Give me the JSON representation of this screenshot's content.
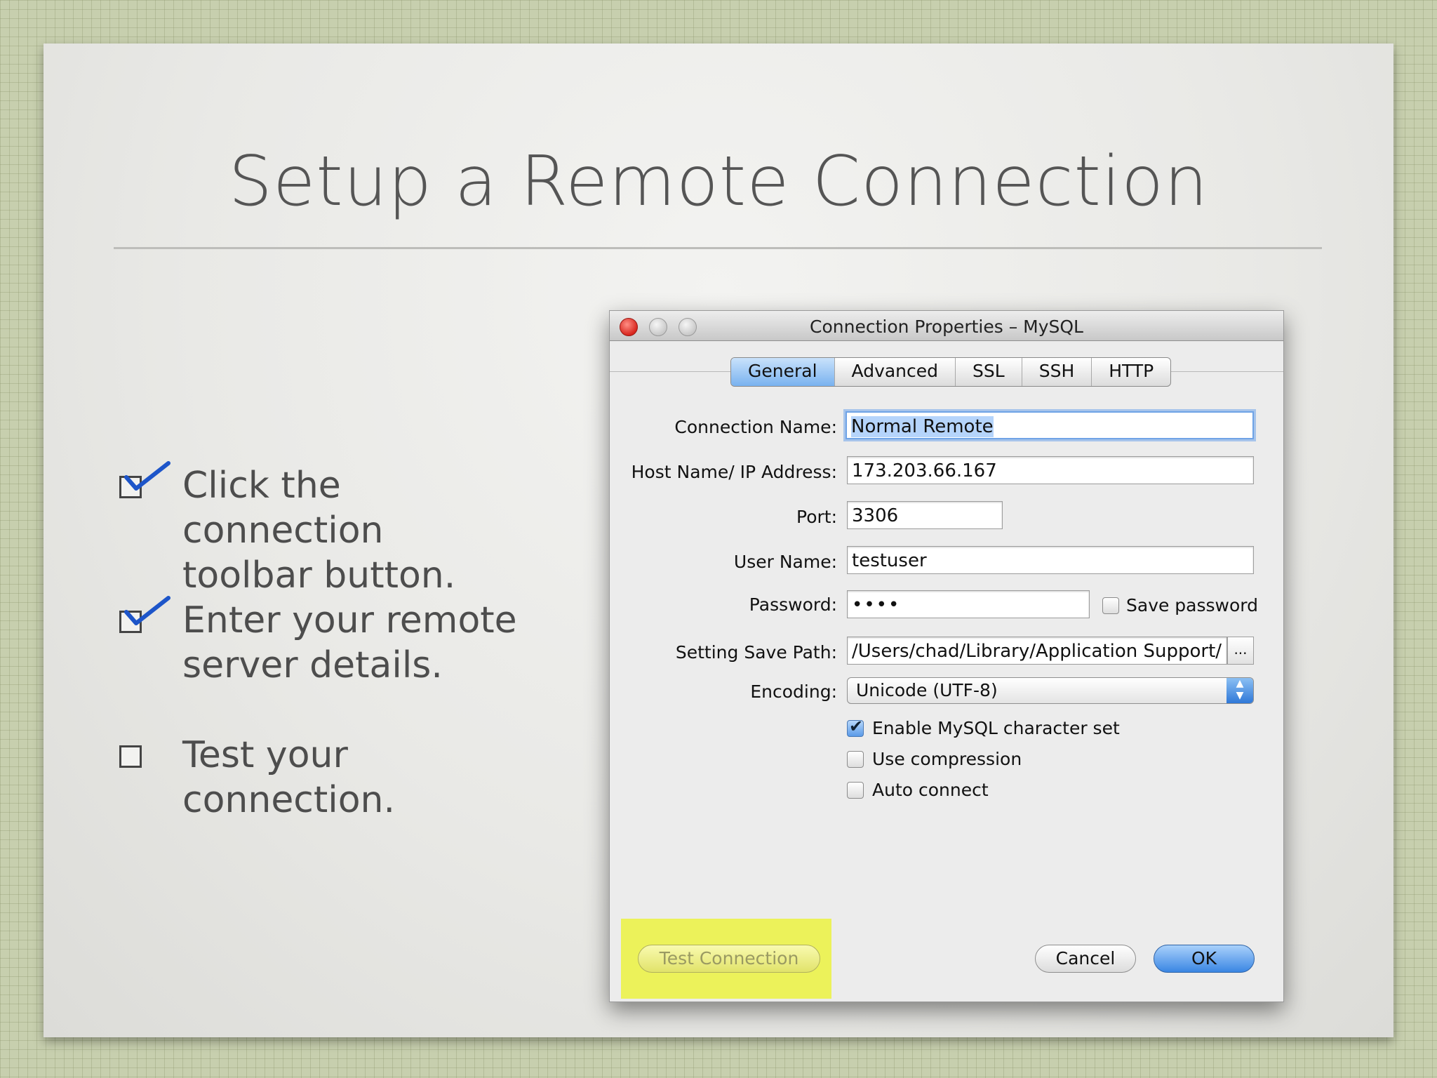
{
  "slide": {
    "title": "Setup a Remote Connection",
    "bullets": [
      {
        "text_line1": "Click the connection",
        "text_line2": "toolbar button.",
        "checked": true
      },
      {
        "text_line1": "Enter your remote",
        "text_line2": "server details.",
        "checked": true
      },
      {
        "text_line1": "Test your",
        "text_line2": "connection.",
        "checked": false
      }
    ]
  },
  "dialog": {
    "title": "Connection Properties – MySQL",
    "tabs": [
      "General",
      "Advanced",
      "SSL",
      "SSH",
      "HTTP"
    ],
    "active_tab": "General",
    "fields": {
      "connection_name": {
        "label": "Connection Name:",
        "value": "Normal Remote"
      },
      "host": {
        "label": "Host Name/ IP Address:",
        "value": "173.203.66.167"
      },
      "port": {
        "label": "Port:",
        "value": "3306"
      },
      "user": {
        "label": "User Name:",
        "value": "testuser"
      },
      "password": {
        "label": "Password:",
        "value": "••••"
      },
      "save_path": {
        "label": "Setting Save Path:",
        "value": "/Users/chad/Library/Application Support/",
        "browse": "..."
      },
      "encoding": {
        "label": "Encoding:",
        "value": "Unicode (UTF-8)"
      }
    },
    "save_password": {
      "label": "Save password",
      "checked": false
    },
    "options": [
      {
        "label": "Enable MySQL character set",
        "checked": true
      },
      {
        "label": "Use compression",
        "checked": false
      },
      {
        "label": "Auto connect",
        "checked": false
      }
    ],
    "buttons": {
      "test": "Test Connection",
      "cancel": "Cancel",
      "ok": "OK"
    },
    "colors": {
      "highlight": "#ecf25a",
      "accent": "#3a86e3"
    }
  }
}
